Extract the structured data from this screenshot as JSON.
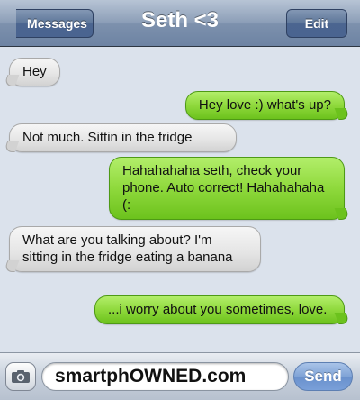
{
  "navbar": {
    "back_label": "Messages",
    "title": "Seth <3",
    "edit_label": "Edit"
  },
  "messages": [
    {
      "direction": "incoming",
      "text": "Hey"
    },
    {
      "direction": "outgoing",
      "text": "Hey love :) what's up?"
    },
    {
      "direction": "incoming",
      "text": "Not much. Sittin in the fridge"
    },
    {
      "direction": "outgoing",
      "text": "Hahahahaha seth, check your phone. Auto correct! Hahahahaha (:"
    },
    {
      "direction": "incoming",
      "text": "What are you talking about? I'm sitting in the fridge eating a banana"
    },
    {
      "direction": "outgoing",
      "text": "...i worry about you sometimes, love."
    }
  ],
  "compose": {
    "camera_icon": "camera-icon",
    "field_text": "smartphOWNED.com",
    "send_label": "Send"
  },
  "colors": {
    "incoming_bubble": "#e6e6e6",
    "outgoing_bubble": "#8fd93c",
    "navbar": "#7d91ad",
    "background": "#dbe2ec"
  }
}
